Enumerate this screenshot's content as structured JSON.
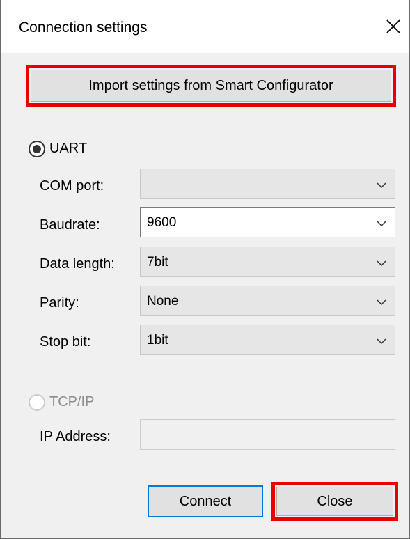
{
  "window": {
    "title": "Connection settings"
  },
  "import_button": {
    "label": "Import settings from Smart Configurator"
  },
  "uart": {
    "label": "UART",
    "selected": true,
    "fields": [
      {
        "label": "COM port:",
        "value": ""
      },
      {
        "label": "Baudrate:",
        "value": "9600"
      },
      {
        "label": "Data length:",
        "value": "7bit"
      },
      {
        "label": "Parity:",
        "value": "None"
      },
      {
        "label": "Stop bit:",
        "value": "1bit"
      }
    ]
  },
  "tcpip": {
    "label": "TCP/IP",
    "selected": false,
    "ip_label": "IP Address:",
    "ip_value": ""
  },
  "buttons": {
    "connect": "Connect",
    "close": "Close"
  },
  "colors": {
    "highlight": "#e60000",
    "focus": "#0078d7"
  },
  "icons": [
    "close-icon",
    "chevron-down-icon"
  ]
}
